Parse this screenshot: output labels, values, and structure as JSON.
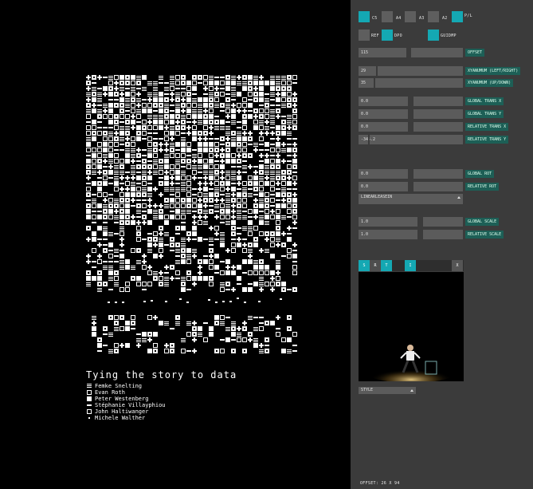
{
  "canvas": {
    "legend_title": "Tying the story to data",
    "people": [
      "Femke Snelting",
      "Evan Roth",
      "Peter Westenberg",
      "Stéphanie Villayphiou",
      "John Haltiwanger",
      "Michele Walther"
    ]
  },
  "panel": {
    "paper_buttons": [
      {
        "label": "C5",
        "on": true
      },
      {
        "label": "A4",
        "on": false
      },
      {
        "label": "A3",
        "on": false
      },
      {
        "label": "A2",
        "on": false
      },
      {
        "label": "P/L",
        "on": true
      }
    ],
    "toggle_buttons": [
      {
        "label": "REF",
        "on": false
      },
      {
        "label": "DPO",
        "on": true
      },
      {
        "label": "GUIDMP",
        "on": true
      }
    ],
    "offset": {
      "value": "115",
      "label": "OFFSET"
    },
    "xyanimum_lr": {
      "value": "29",
      "label": "XYANUMUM  (LEFT/RIGHT)"
    },
    "xyanimum_ud": {
      "value": "35",
      "label": "XYANUMUM  (UP/DOWN)"
    },
    "global_trans_x": {
      "value": "0.0",
      "label": "GLOBAL TRANS X"
    },
    "global_trans_y": {
      "value": "0.0",
      "label": "GLOBAL TRANS Y"
    },
    "relative_trans_x": {
      "value": "0.0",
      "label": "RELATIVE TRANS X"
    },
    "relative_trans_y": {
      "value": "-345.2",
      "label": "RELATIVE TRANS Y"
    },
    "global_rot": {
      "value": "0.0",
      "label": "GLOBAL ROT"
    },
    "relative_rot": {
      "value": "0.0",
      "label": "RELATIVE ROT"
    },
    "easing_select": "LINEARLEASEIN",
    "global_scale": {
      "value": "1.0",
      "label": "GLOBAL SCALE"
    },
    "relative_scale": {
      "value": "1.0",
      "label": "RELATIVE SCALE"
    },
    "preview_tabs": [
      "S",
      "R",
      "T",
      "I"
    ],
    "preview_close": "X",
    "style_select": "STYLE",
    "status": "OFFSET: 26 X 94"
  },
  "colors": {
    "accent": "#14a8b3",
    "panel": "#3b3b3b",
    "field": "#5b5b5b",
    "tag": "#1d5f56"
  }
}
